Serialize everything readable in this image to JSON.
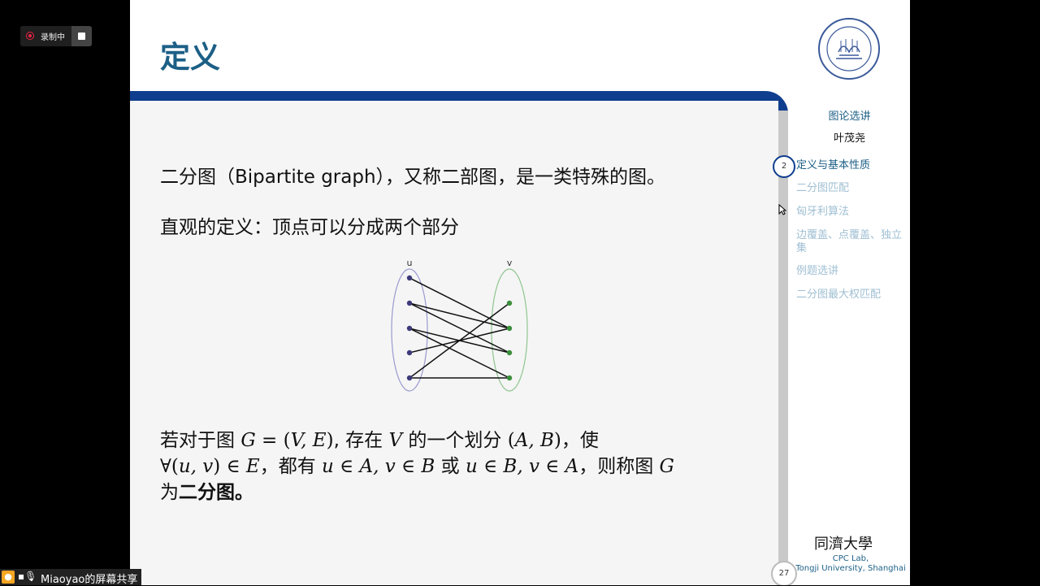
{
  "slide": {
    "title": "定义",
    "paragraph1": "二分图（Bipartite graph），又称二部图，是一类特殊的图。",
    "paragraph2": "直观的定义：顶点可以分成两个部分",
    "definition": {
      "t1": "若对于图 ",
      "m1": "G",
      "r1": " = (",
      "m2": "V, E",
      "r2": ")",
      "t2": ", 存在 ",
      "m3": "V",
      "t3": " 的一个划分 ",
      "r3": "(",
      "m4": "A, B",
      "r4": ")",
      "t4": "，使",
      "r5": "∀(",
      "m5": "u, v",
      "r6": ") ∈ ",
      "m6": "E",
      "t5": "，都有 ",
      "m7": "u",
      "r7": " ∈ ",
      "m8": "A, v",
      "r8": " ∈ ",
      "m9": "B",
      "t6": " 或 ",
      "m10": "u",
      "r9": " ∈ ",
      "m11": "B, v",
      "r10": " ∈ ",
      "m12": "A",
      "t7": "，则称图 ",
      "m13": "G",
      "t8": "为",
      "bold": "二分图。"
    },
    "graph": {
      "left_label": "u",
      "right_label": "v",
      "left_color": "#3d3a7a",
      "right_color": "#3c8f3c",
      "edges": [
        [
          0,
          1
        ],
        [
          1,
          1
        ],
        [
          1,
          2
        ],
        [
          2,
          2
        ],
        [
          2,
          3
        ],
        [
          3,
          1
        ],
        [
          4,
          0
        ],
        [
          4,
          3
        ]
      ]
    }
  },
  "sidebar": {
    "title": "图论选讲",
    "author": "叶茂尧",
    "current_page": "2",
    "total_pages": "27",
    "toc": [
      "定义与基本性质",
      "二分图匹配",
      "匈牙利算法",
      "边覆盖、点覆盖、独立集",
      "例题选讲",
      "二分图最大权匹配"
    ],
    "footer_university": "同濟大學",
    "footer_lab_line1": "CPC Lab,",
    "footer_lab_line2": "Tongji University, Shanghai"
  },
  "overlay": {
    "recording_label": "录制中",
    "share_label": "Miaoyao的屏幕共享"
  },
  "colors": {
    "title": "#1c5f86",
    "banner": "#0f3e8e",
    "toc_active": "#1c5f86",
    "toc_inactive": "#9fbfd3"
  }
}
